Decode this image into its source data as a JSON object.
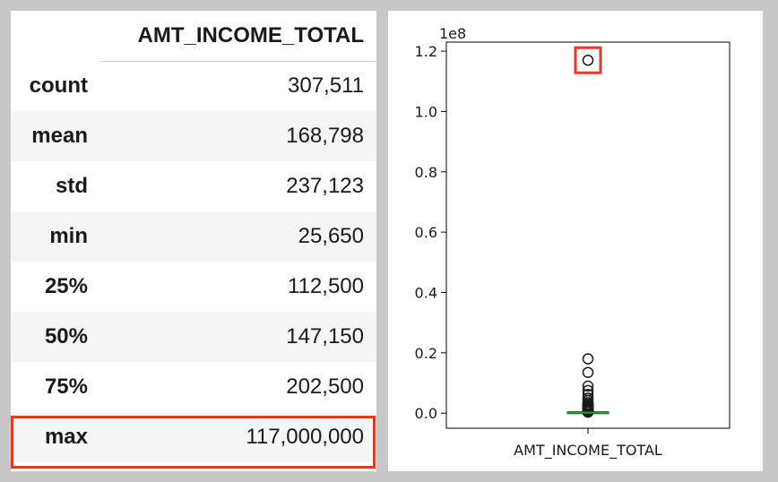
{
  "table": {
    "column_header": "AMT_INCOME_TOTAL",
    "rows": [
      {
        "label": "count",
        "value": "307,511"
      },
      {
        "label": "mean",
        "value": "168,798"
      },
      {
        "label": "std",
        "value": "237,123"
      },
      {
        "label": "min",
        "value": "25,650"
      },
      {
        "label": "25%",
        "value": "112,500"
      },
      {
        "label": "50%",
        "value": "147,150"
      },
      {
        "label": "75%",
        "value": "202,500"
      },
      {
        "label": "max",
        "value": "117,000,000"
      }
    ],
    "highlight_color": "#e03a2e"
  },
  "chart_data": {
    "type": "box",
    "title": "",
    "categories": [
      "AMT_INCOME_TOTAL"
    ],
    "xlabel": "",
    "ylabel": "",
    "y_scale_label": "1e8",
    "ylim": [
      -0.05,
      1.23
    ],
    "yticks": [
      0.0,
      0.2,
      0.4,
      0.6,
      0.8,
      1.0,
      1.2
    ],
    "ytick_labels": [
      "0.0",
      "0.2",
      "0.4",
      "0.6",
      "0.8",
      "1.0",
      "1.2"
    ],
    "box": {
      "q1": 0.001125,
      "median": 0.0014715,
      "q3": 0.002025
    },
    "outliers": [
      0.18,
      0.135,
      0.09,
      0.075,
      0.062,
      0.05,
      0.042,
      0.035,
      0.028,
      0.022,
      0.017,
      0.012,
      0.008,
      0.005,
      1.17
    ],
    "highlighted_outlier": 1.17,
    "grid": false,
    "colors": {
      "median": "#2ca02c",
      "outlier": "#1a1a1a",
      "highlight": "#e03a2e"
    }
  }
}
